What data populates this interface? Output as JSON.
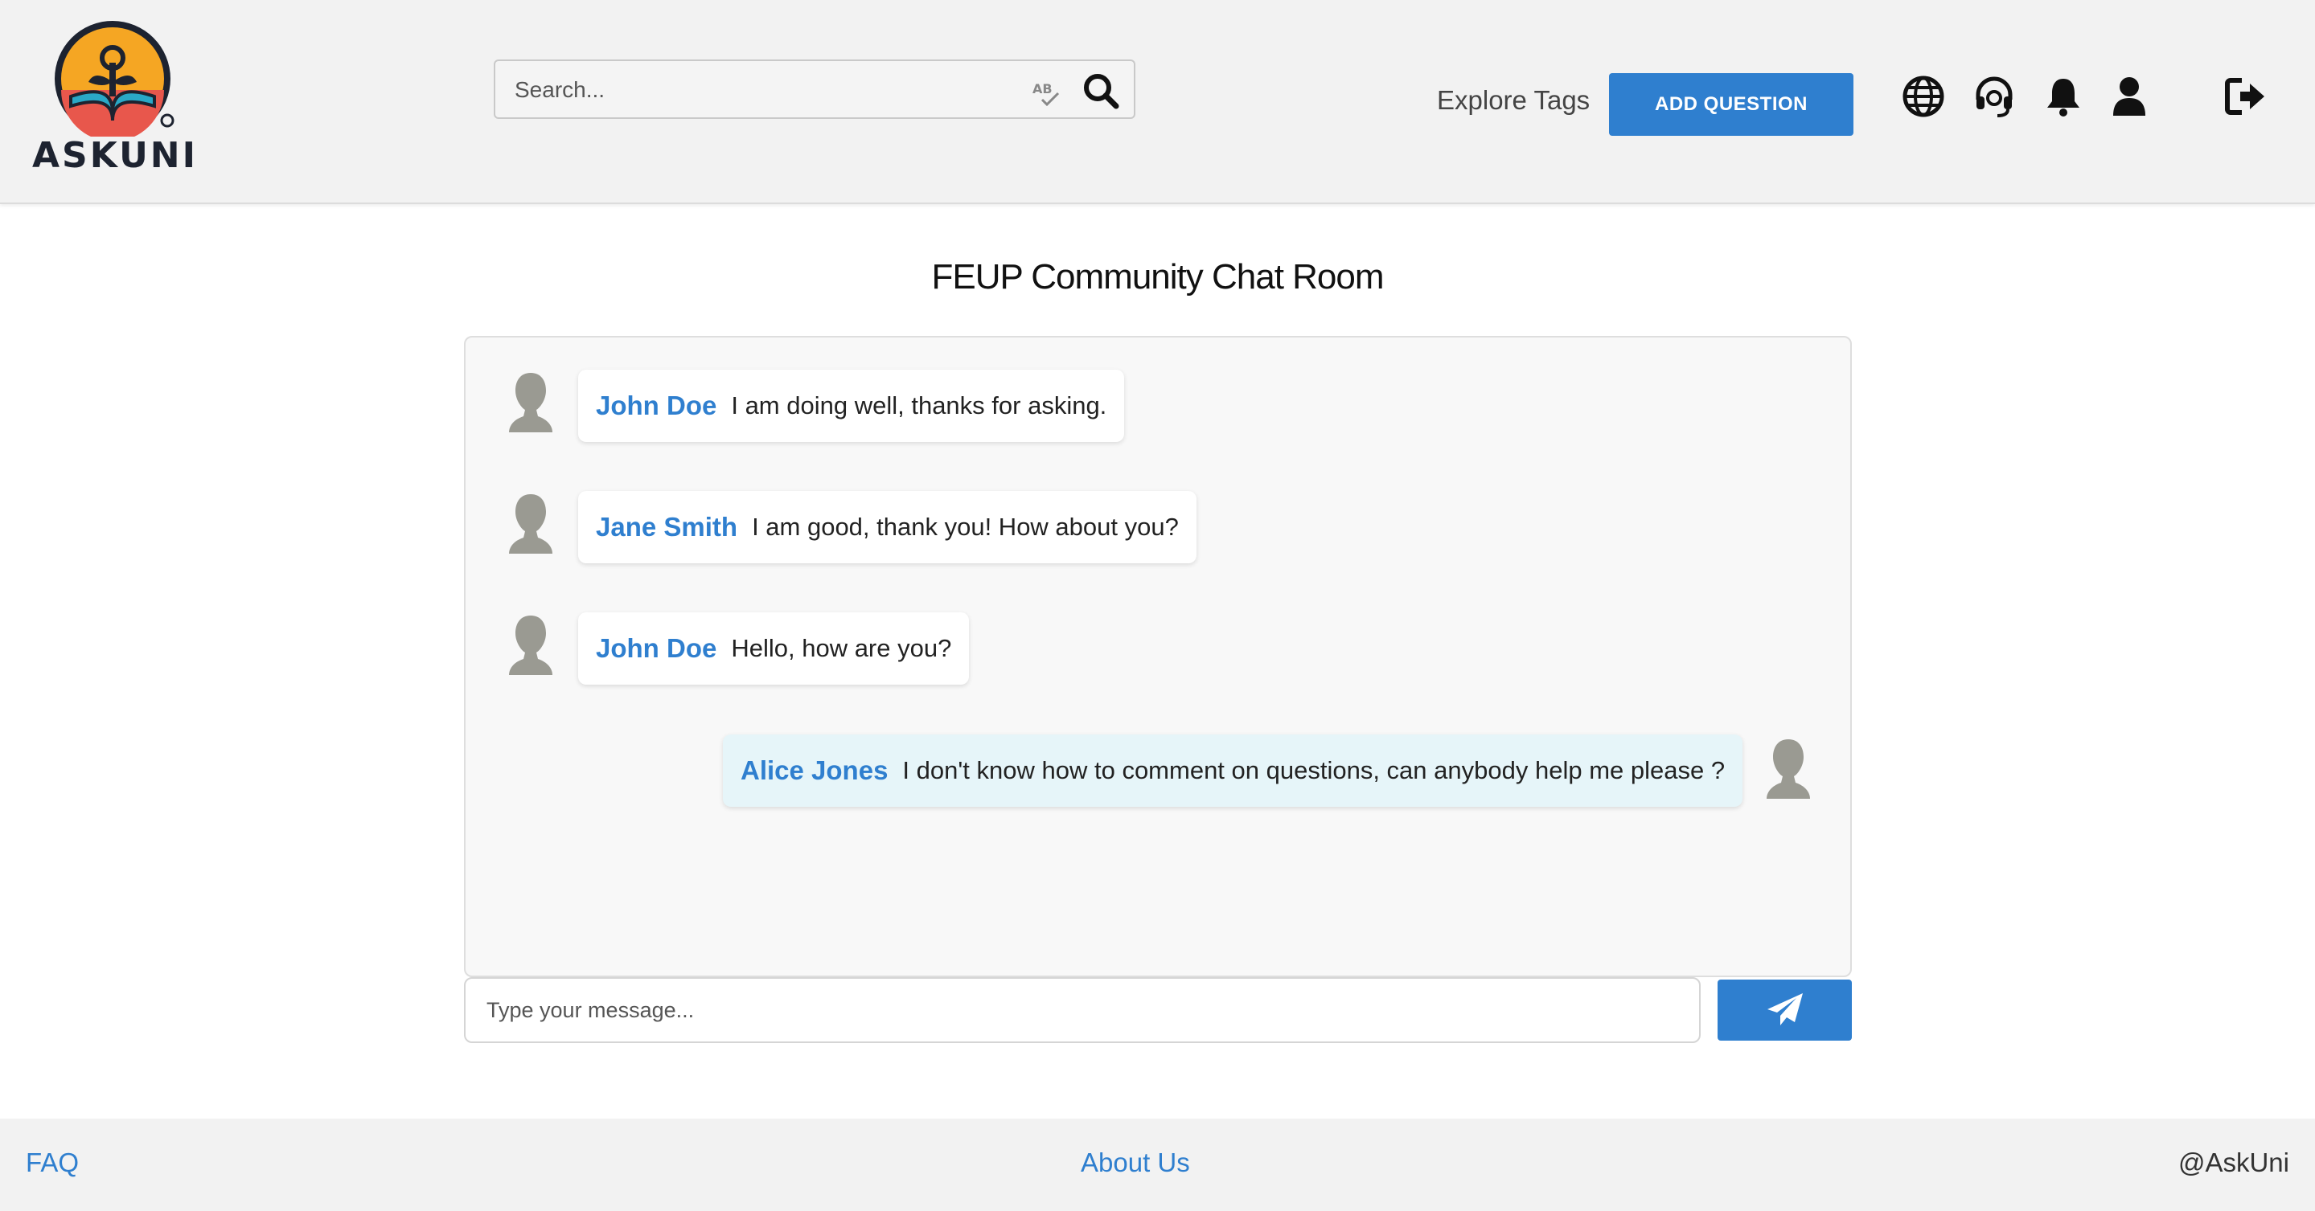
{
  "header": {
    "logo_text": "ASKUNI",
    "search": {
      "placeholder": "Search...",
      "value": ""
    },
    "explore_tags_label": "Explore Tags",
    "add_question_label": "ADD QUESTION",
    "icons": [
      "globe-icon",
      "headset-icon",
      "bell-icon",
      "user-icon",
      "logout-icon"
    ]
  },
  "chat": {
    "title": "FEUP Community Chat Room",
    "messages": [
      {
        "sender": "John Doe",
        "text": "I am doing well, thanks for asking.",
        "self": false
      },
      {
        "sender": "Jane Smith",
        "text": "I am good, thank you! How about you?",
        "self": false
      },
      {
        "sender": "John Doe",
        "text": "Hello, how are you?",
        "self": false
      },
      {
        "sender": "Alice Jones",
        "text": "I don't know how to comment on questions, can anybody help me please ?",
        "self": true
      }
    ],
    "input": {
      "placeholder": "Type your message...",
      "value": ""
    }
  },
  "footer": {
    "faq": "FAQ",
    "about": "About Us",
    "handle": "@AskUni"
  },
  "colors": {
    "accent": "#2f7fcf",
    "header_bg": "#f2f2f2",
    "own_bubble": "#e6f5f9"
  }
}
